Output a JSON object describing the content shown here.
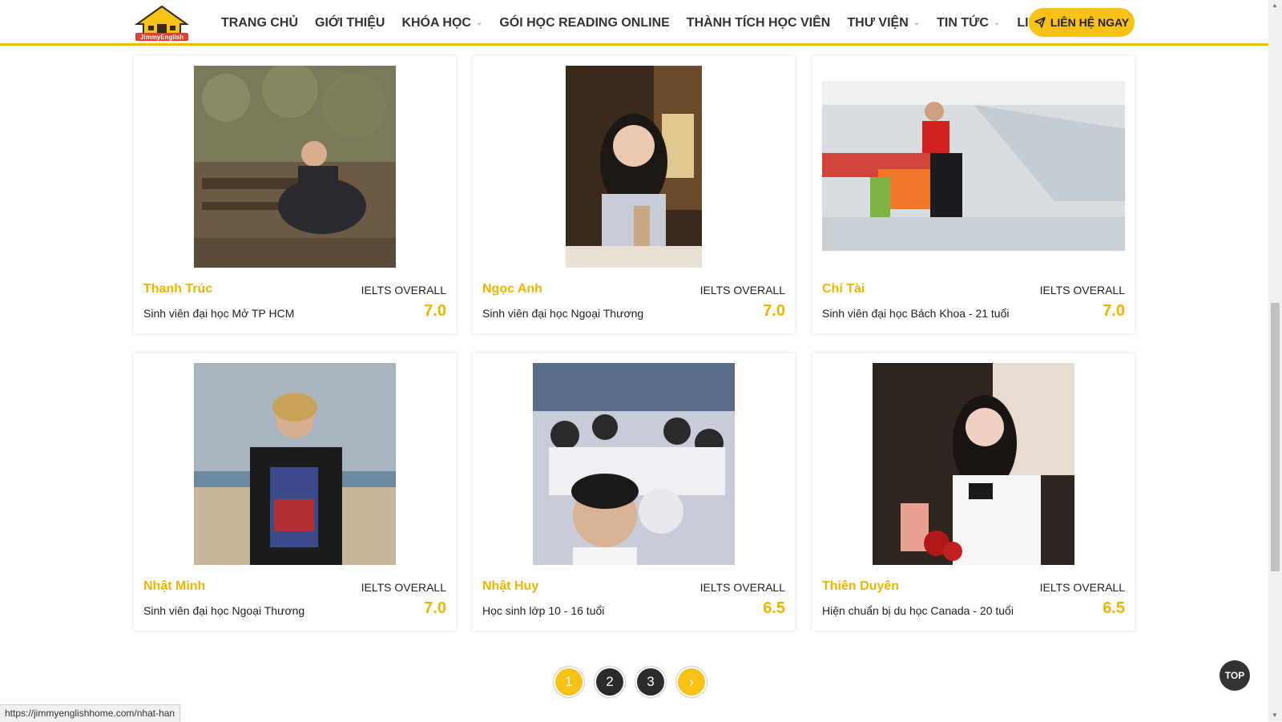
{
  "header": {
    "logo_text": "JimmyEnglish",
    "nav": [
      {
        "label": "TRANG CHỦ",
        "dropdown": false
      },
      {
        "label": "GIỚI THIỆU",
        "dropdown": false
      },
      {
        "label": "KHÓA HỌC",
        "dropdown": true
      },
      {
        "label": "GÓI HỌC READING ONLINE",
        "dropdown": false
      },
      {
        "label": "THÀNH TÍCH HỌC VIÊN",
        "dropdown": false
      },
      {
        "label": "THƯ VIỆN",
        "dropdown": true
      },
      {
        "label": "TIN TỨC",
        "dropdown": true
      },
      {
        "label": "LIÊN HỆ",
        "dropdown": false
      }
    ],
    "cta_label": "LIÊN HỆ NGAY"
  },
  "students": [
    {
      "name": "Thanh Trúc",
      "exam": "IELTS OVERALL",
      "desc": "Sinh viên đại học Mở TP HCM",
      "score": "7.0"
    },
    {
      "name": "Ngọc Anh",
      "exam": "IELTS OVERALL",
      "desc": "Sinh viên đại học Ngoại Thương",
      "score": "7.0"
    },
    {
      "name": "Chí Tài",
      "exam": "IELTS OVERALL",
      "desc": "Sinh viên đại học Bách Khoa - 21 tuổi",
      "score": "7.0"
    },
    {
      "name": "Nhật Minh",
      "exam": "IELTS OVERALL",
      "desc": "Sinh viên đại học Ngoại Thương",
      "score": "7.0"
    },
    {
      "name": "Nhật Huy",
      "exam": "IELTS OVERALL",
      "desc": "Học sinh lớp 10 - 16 tuổi",
      "score": "6.5"
    },
    {
      "name": "Thiên Duyên",
      "exam": "IELTS OVERALL",
      "desc": "Hiện chuẩn bị du học Canada - 20 tuổi",
      "score": "6.5"
    }
  ],
  "pagination": {
    "pages": [
      "1",
      "2",
      "3"
    ],
    "active": "1",
    "next": "›"
  },
  "top_button": "TOP",
  "status_url": "https://jimmyenglishhome.com/nhat-han",
  "colors": {
    "accent": "#f7c215",
    "name": "#f0b400",
    "dark": "#2b2b2b"
  }
}
